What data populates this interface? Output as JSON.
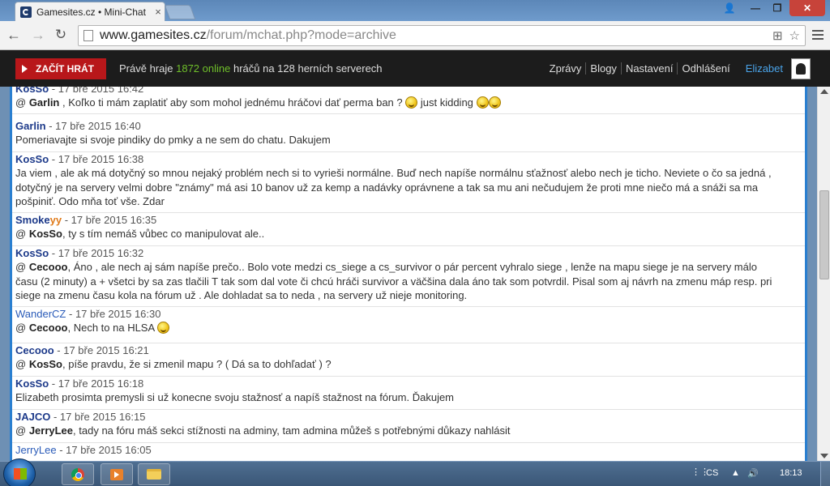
{
  "browser": {
    "tab_title": "Gamesites.cz • Mini-Chat",
    "tab_close": "×",
    "url_host": "www.gamesites.cz",
    "url_path": "/forum/mchat.php?mode=archive",
    "back_icon": "←",
    "forward_icon": "→",
    "reload_icon": "↻",
    "translate_icon": "⊞",
    "star_icon": "☆",
    "win_user": "👤",
    "win_min": "—",
    "win_max": "❐",
    "win_close": "✕"
  },
  "site": {
    "play_button": "ZAČÍT HRÁT",
    "status_prefix": "Právě hraje",
    "status_count": "1872 online",
    "status_suffix": "hráčů na 128 herních serverech",
    "nav": [
      "Zprávy",
      "Blogy",
      "Nastavení",
      "Odhlášení"
    ],
    "username": "Elizabet"
  },
  "messages": [
    {
      "author": "KosSo",
      "date": "17 bře 2015 16:42",
      "text_html": "@ <b>Garlin</b> , Koľko ti mám zaplatiť aby som mohol jednému hráčovi dať perma ban ? <span class='emoji'></span> just kidding <span class='emoji'></span><span class='emoji'></span>"
    },
    {
      "author": "Garlin",
      "date": "17 bře 2015 16:40",
      "text_html": "Pomeriavajte si svoje pindiky do pmky a ne sem do chatu. Dakujem"
    },
    {
      "author": "KosSo",
      "date": "17 bře 2015 16:38",
      "text_html": "Ja viem , ale ak má dotyčný so mnou nejaký problém nech si to vyrieši normálne. Buď nech napíše normálnu sťažnosť alebo nech je ticho. Neviete o čo sa jedná , dotyčný je na servery velmi dobre \"známy\" má asi 10 banov už za kemp a nadávky oprávnene a tak sa mu ani nečudujem že proti mne niečo má a snáži sa ma pošpiniť. Odo mňa toť vše. Zdar"
    },
    {
      "author": "Smokeyy",
      "date": "17 bře 2015 16:35",
      "text_html": "@ <b>KosSo</b>, ty s tím nemáš vůbec co manipulovat ale.."
    },
    {
      "author": "KosSo",
      "date": "17 bře 2015 16:32",
      "text_html": "@ <b>Cecooo</b>, Áno , ale nech aj sám napíše prečo.. Bolo vote medzi cs_siege a cs_survivor o pár percent vyhralo siege , lenže na mapu siege je na servery málo času (2 minuty) a + všetci by sa zas tlačili T tak som dal vote či chcú hráči survivor a väčšina dala áno tak som potvrdil. Pisal som aj návrh na zmenu máp resp. pri siege na zmenu času kola na fórum už . Ale dohladat sa to neda , na servery už nieje monitoring."
    },
    {
      "author": "WanderCZ",
      "date": "17 bře 2015 16:30",
      "text_html": "@ <b>Cecooo</b>, Nech to na HLSA <span class='emoji'></span>"
    },
    {
      "author": "Cecooo",
      "date": "17 bře 2015 16:21",
      "text_html": "@ <b>KosSo</b>, píše pravdu, že si zmenil mapu ? ( Dá sa to dohľadať ) ?"
    },
    {
      "author": "KosSo",
      "date": "17 bře 2015 16:18",
      "text_html": "Elizabeth prosimta premysli si už konecne svoju stažnosť a napíš stažnost na fórum. Ďakujem"
    },
    {
      "author": "JAJCO",
      "date": "17 bře 2015 16:15",
      "text_html": "@ <b>JerryLee</b>, tady na fóru máš sekci stížnosti na adminy, tam admina můžeš s potřebnými důkazy nahlásit"
    },
    {
      "author": "JerryLee",
      "date": "17 bře 2015 16:05",
      "text_html": ""
    }
  ],
  "taskbar": {
    "lang": "CS",
    "clock": "18:13",
    "tray_up": "▲",
    "volume_icon": "🔊",
    "grip": "⋮⋮"
  }
}
